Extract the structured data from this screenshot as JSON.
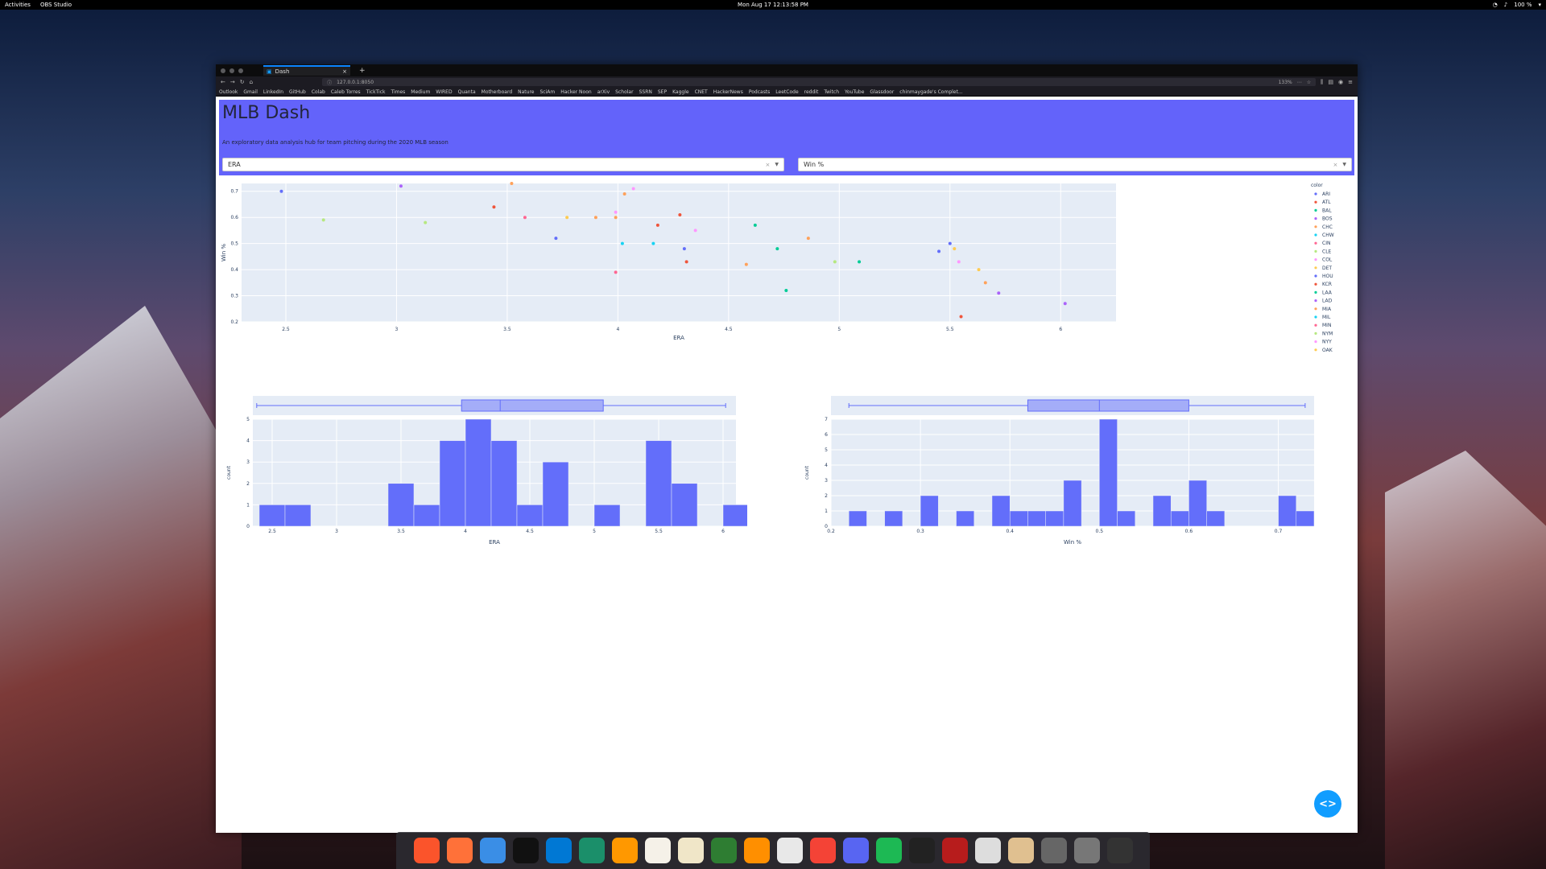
{
  "system": {
    "activities": "Activities",
    "app_menu": "OBS Studio",
    "clock": "Mon Aug 17  12:13:58 PM",
    "battery": "100 %"
  },
  "browser": {
    "tab_title": "Dash",
    "url": "127.0.0.1:8050",
    "zoom": "133%",
    "bookmarks": [
      "Outlook",
      "Gmail",
      "LinkedIn",
      "GitHub",
      "Colab",
      "Caleb Torres",
      "TickTick",
      "Times",
      "Medium",
      "WIRED",
      "Quanta",
      "Motherboard",
      "Nature",
      "SciAm",
      "Hacker Noon",
      "arXiv",
      "Scholar",
      "SSRN",
      "SEP",
      "Kaggle",
      "CNET",
      "HackerNews",
      "Podcasts",
      "LeetCode",
      "reddit",
      "Twitch",
      "YouTube",
      "Glassdoor",
      "chinmaygade's Complet..."
    ]
  },
  "app": {
    "title": "MLB Dash",
    "subtitle": "An exploratory data analysis hub for team pitching during the 2020 MLB season",
    "dropdown_x": "ERA",
    "dropdown_y": "Win %",
    "clear_glyph": "×",
    "fab_label": "<>"
  },
  "dock": [
    "brave-icon",
    "firefox-icon",
    "finder-icon",
    "terminal-icon",
    "vscode-icon",
    "atom-icon",
    "sublime-icon",
    "notes-icon",
    "textedit-icon",
    "numbers-icon",
    "books-icon",
    "egg-icon",
    "calendar-icon",
    "discord-icon",
    "spotify-icon",
    "obs-icon",
    "filezilla-icon",
    "screenshot-icon",
    "installer-icon",
    "preferences-icon",
    "settings-icon",
    "keyboard-icon"
  ],
  "chart_data": [
    {
      "type": "scatter",
      "xlabel": "ERA",
      "ylabel": "Win %",
      "xlim": [
        2.3,
        6.25
      ],
      "ylim": [
        0.2,
        0.73
      ],
      "xticks": [
        2.5,
        3,
        3.5,
        4,
        4.5,
        5,
        5.5,
        6
      ],
      "yticks": [
        0.2,
        0.3,
        0.4,
        0.5,
        0.6,
        0.7
      ],
      "legend_title": "color",
      "legend_position": "right",
      "grid": true,
      "series": [
        {
          "name": "ARI",
          "color": "#636efa",
          "x": [
            3.72
          ],
          "y": [
            0.52
          ]
        },
        {
          "name": "ATL",
          "color": "#ef553b",
          "x": [
            4.28
          ],
          "y": [
            0.61
          ]
        },
        {
          "name": "BAL",
          "color": "#00cc96",
          "x": [
            4.76
          ],
          "y": [
            0.32
          ]
        },
        {
          "name": "BOS",
          "color": "#ab63fa",
          "x": [
            6.02
          ],
          "y": [
            0.27
          ]
        },
        {
          "name": "CHC",
          "color": "#ffa15a",
          "x": [
            3.99
          ],
          "y": [
            0.6
          ]
        },
        {
          "name": "CHW",
          "color": "#19d3f3",
          "x": [
            4.02
          ],
          "y": [
            0.5
          ]
        },
        {
          "name": "CIN",
          "color": "#ff6692",
          "x": [
            3.99
          ],
          "y": [
            0.39
          ]
        },
        {
          "name": "CLE",
          "color": "#b6e880",
          "x": [
            3.13
          ],
          "y": [
            0.58
          ]
        },
        {
          "name": "COL",
          "color": "#ff97ff",
          "x": [
            5.54
          ],
          "y": [
            0.43
          ]
        },
        {
          "name": "DET",
          "color": "#fecb52",
          "x": [
            5.63
          ],
          "y": [
            0.4
          ]
        },
        {
          "name": "HOU",
          "color": "#636efa",
          "x": [
            4.3
          ],
          "y": [
            0.48
          ]
        },
        {
          "name": "KCR",
          "color": "#ef553b",
          "x": [
            4.31
          ],
          "y": [
            0.43
          ]
        },
        {
          "name": "LAA",
          "color": "#00cc96",
          "x": [
            5.09
          ],
          "y": [
            0.43
          ]
        },
        {
          "name": "LAD",
          "color": "#ab63fa",
          "x": [
            3.02
          ],
          "y": [
            0.72
          ]
        },
        {
          "name": "MIA",
          "color": "#ffa15a",
          "x": [
            4.86
          ],
          "y": [
            0.52
          ]
        },
        {
          "name": "MIL",
          "color": "#19d3f3",
          "x": [
            4.16
          ],
          "y": [
            0.5
          ]
        },
        {
          "name": "MIN",
          "color": "#ff6692",
          "x": [
            3.58
          ],
          "y": [
            0.6
          ]
        },
        {
          "name": "NYM",
          "color": "#b6e880",
          "x": [
            4.98
          ],
          "y": [
            0.43
          ]
        },
        {
          "name": "NYY",
          "color": "#ff97ff",
          "x": [
            4.35
          ],
          "y": [
            0.55
          ]
        },
        {
          "name": "OAK",
          "color": "#fecb52",
          "x": [
            3.77
          ],
          "y": [
            0.6
          ]
        }
      ],
      "extra_points": [
        {
          "x": 2.48,
          "y": 0.7,
          "color": "#636efa"
        },
        {
          "x": 2.67,
          "y": 0.59,
          "color": "#b6e880"
        },
        {
          "x": 3.44,
          "y": 0.64,
          "color": "#ef553b"
        },
        {
          "x": 3.52,
          "y": 0.73,
          "color": "#ffa15a"
        },
        {
          "x": 3.9,
          "y": 0.6,
          "color": "#ffa15a"
        },
        {
          "x": 3.99,
          "y": 0.62,
          "color": "#ff97ff"
        },
        {
          "x": 4.03,
          "y": 0.69,
          "color": "#ffa15a"
        },
        {
          "x": 4.07,
          "y": 0.71,
          "color": "#ff97ff"
        },
        {
          "x": 4.18,
          "y": 0.57,
          "color": "#ef553b"
        },
        {
          "x": 4.62,
          "y": 0.57,
          "color": "#00cc96"
        },
        {
          "x": 4.72,
          "y": 0.48,
          "color": "#00cc96"
        },
        {
          "x": 4.58,
          "y": 0.42,
          "color": "#ffa15a"
        },
        {
          "x": 5.45,
          "y": 0.47,
          "color": "#636efa"
        },
        {
          "x": 5.5,
          "y": 0.5,
          "color": "#636efa"
        },
        {
          "x": 5.52,
          "y": 0.48,
          "color": "#fecb52"
        },
        {
          "x": 5.55,
          "y": 0.22,
          "color": "#ef553b"
        },
        {
          "x": 5.66,
          "y": 0.35,
          "color": "#ffa15a"
        },
        {
          "x": 5.72,
          "y": 0.31,
          "color": "#ab63fa"
        }
      ]
    },
    {
      "type": "bar",
      "subtype": "histogram with marginal box plot",
      "xlabel": "ERA",
      "ylabel": "count",
      "xlim": [
        2.35,
        6.1
      ],
      "ylim": [
        0,
        5
      ],
      "xticks": [
        2.5,
        3,
        3.5,
        4,
        4.5,
        5,
        5.5,
        6
      ],
      "yticks": [
        0,
        1,
        2,
        3,
        4,
        5
      ],
      "bin_width": 0.2,
      "bin_starts": [
        2.4,
        2.6,
        2.8,
        3.0,
        3.2,
        3.4,
        3.6,
        3.8,
        4.0,
        4.2,
        4.4,
        4.6,
        4.8,
        5.0,
        5.2,
        5.4,
        5.6,
        5.8,
        6.0
      ],
      "values": [
        1,
        1,
        0,
        0,
        0,
        2,
        1,
        4,
        5,
        4,
        1,
        3,
        0,
        1,
        0,
        4,
        2,
        0,
        1
      ],
      "box": {
        "min": 2.38,
        "q1": 3.97,
        "median": 4.27,
        "q3": 5.07,
        "max": 6.02
      }
    },
    {
      "type": "bar",
      "subtype": "histogram with marginal box plot",
      "xlabel": "Win %",
      "ylabel": "count",
      "xlim": [
        0.2,
        0.74
      ],
      "ylim": [
        0,
        7
      ],
      "xticks": [
        0.2,
        0.3,
        0.4,
        0.5,
        0.6,
        0.7
      ],
      "yticks": [
        0,
        1,
        2,
        3,
        4,
        5,
        6,
        7
      ],
      "bin_width": 0.02,
      "bin_starts": [
        0.2,
        0.22,
        0.24,
        0.26,
        0.28,
        0.3,
        0.32,
        0.34,
        0.36,
        0.38,
        0.4,
        0.42,
        0.44,
        0.46,
        0.48,
        0.5,
        0.52,
        0.54,
        0.56,
        0.58,
        0.6,
        0.62,
        0.64,
        0.66,
        0.68,
        0.7,
        0.72
      ],
      "values": [
        0,
        1,
        0,
        1,
        0,
        2,
        0,
        1,
        0,
        2,
        1,
        1,
        1,
        3,
        0,
        7,
        1,
        0,
        2,
        1,
        3,
        1,
        0,
        0,
        0,
        2,
        1
      ],
      "box": {
        "min": 0.22,
        "q1": 0.42,
        "median": 0.5,
        "q3": 0.6,
        "max": 0.73
      }
    }
  ]
}
